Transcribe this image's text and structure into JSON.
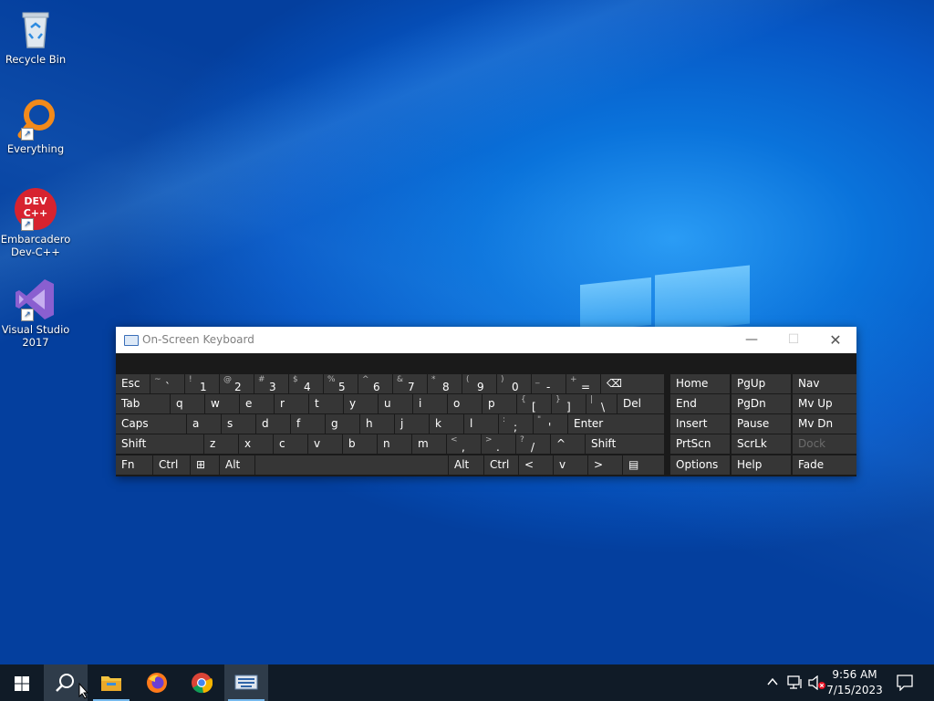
{
  "desktop": {
    "icons": [
      {
        "label": "Recycle Bin",
        "icon": "recycle-bin-icon"
      },
      {
        "label": "Everything",
        "icon": "everything-icon"
      },
      {
        "label": "Embarcadero Dev-C++",
        "icon": "devcpp-icon",
        "badge": "DEV C++"
      },
      {
        "label": "Visual Studio 2017",
        "icon": "visual-studio-icon"
      }
    ]
  },
  "osk": {
    "title": "On-Screen Keyboard",
    "row1": [
      {
        "label": "Esc"
      },
      {
        "shift": "~",
        "main": "`"
      },
      {
        "shift": "!",
        "main": "1"
      },
      {
        "shift": "@",
        "main": "2"
      },
      {
        "shift": "#",
        "main": "3"
      },
      {
        "shift": "$",
        "main": "4"
      },
      {
        "shift": "%",
        "main": "5"
      },
      {
        "shift": "^",
        "main": "6"
      },
      {
        "shift": "&",
        "main": "7"
      },
      {
        "shift": "*",
        "main": "8"
      },
      {
        "shift": "(",
        "main": "9"
      },
      {
        "shift": ")",
        "main": "0"
      },
      {
        "shift": "_",
        "main": "-"
      },
      {
        "shift": "+",
        "main": "="
      },
      {
        "label": "⌫"
      }
    ],
    "row2": [
      {
        "label": "Tab"
      },
      {
        "label": "q"
      },
      {
        "label": "w"
      },
      {
        "label": "e"
      },
      {
        "label": "r"
      },
      {
        "label": "t"
      },
      {
        "label": "y"
      },
      {
        "label": "u"
      },
      {
        "label": "i"
      },
      {
        "label": "o"
      },
      {
        "label": "p"
      },
      {
        "shift": "{",
        "main": "["
      },
      {
        "shift": "}",
        "main": "]"
      },
      {
        "shift": "|",
        "main": "\\"
      },
      {
        "label": "Del"
      }
    ],
    "row3": [
      {
        "label": "Caps"
      },
      {
        "label": "a"
      },
      {
        "label": "s"
      },
      {
        "label": "d"
      },
      {
        "label": "f"
      },
      {
        "label": "g"
      },
      {
        "label": "h"
      },
      {
        "label": "j"
      },
      {
        "label": "k"
      },
      {
        "label": "l"
      },
      {
        "shift": ":",
        "main": ";"
      },
      {
        "shift": "\"",
        "main": "'"
      },
      {
        "label": "Enter"
      }
    ],
    "row4": [
      {
        "label": "Shift"
      },
      {
        "label": "z"
      },
      {
        "label": "x"
      },
      {
        "label": "c"
      },
      {
        "label": "v"
      },
      {
        "label": "b"
      },
      {
        "label": "n"
      },
      {
        "label": "m"
      },
      {
        "shift": "<",
        "main": ","
      },
      {
        "shift": ">",
        "main": "."
      },
      {
        "shift": "?",
        "main": "/"
      },
      {
        "label": "^"
      },
      {
        "label": "Shift"
      }
    ],
    "row5": [
      {
        "label": "Fn"
      },
      {
        "label": "Ctrl"
      },
      {
        "label": "⊞"
      },
      {
        "label": "Alt"
      },
      {
        "label": ""
      },
      {
        "label": "Alt"
      },
      {
        "label": "Ctrl"
      },
      {
        "label": "<"
      },
      {
        "label": "v"
      },
      {
        "label": ">"
      },
      {
        "label": "▤"
      }
    ],
    "nav": [
      [
        "Home",
        "PgUp",
        "Nav"
      ],
      [
        "End",
        "PgDn",
        "Mv Up"
      ],
      [
        "Insert",
        "Pause",
        "Mv Dn"
      ],
      [
        "PrtScn",
        "ScrLk",
        "Dock"
      ],
      [
        "Options",
        "Help",
        "Fade"
      ]
    ]
  },
  "taskbar": {
    "items": [
      "start-icon",
      "search-icon",
      "file-explorer-icon",
      "firefox-icon",
      "chrome-icon",
      "on-screen-keyboard-icon"
    ],
    "time": "9:56 AM",
    "date": "7/15/2023"
  }
}
